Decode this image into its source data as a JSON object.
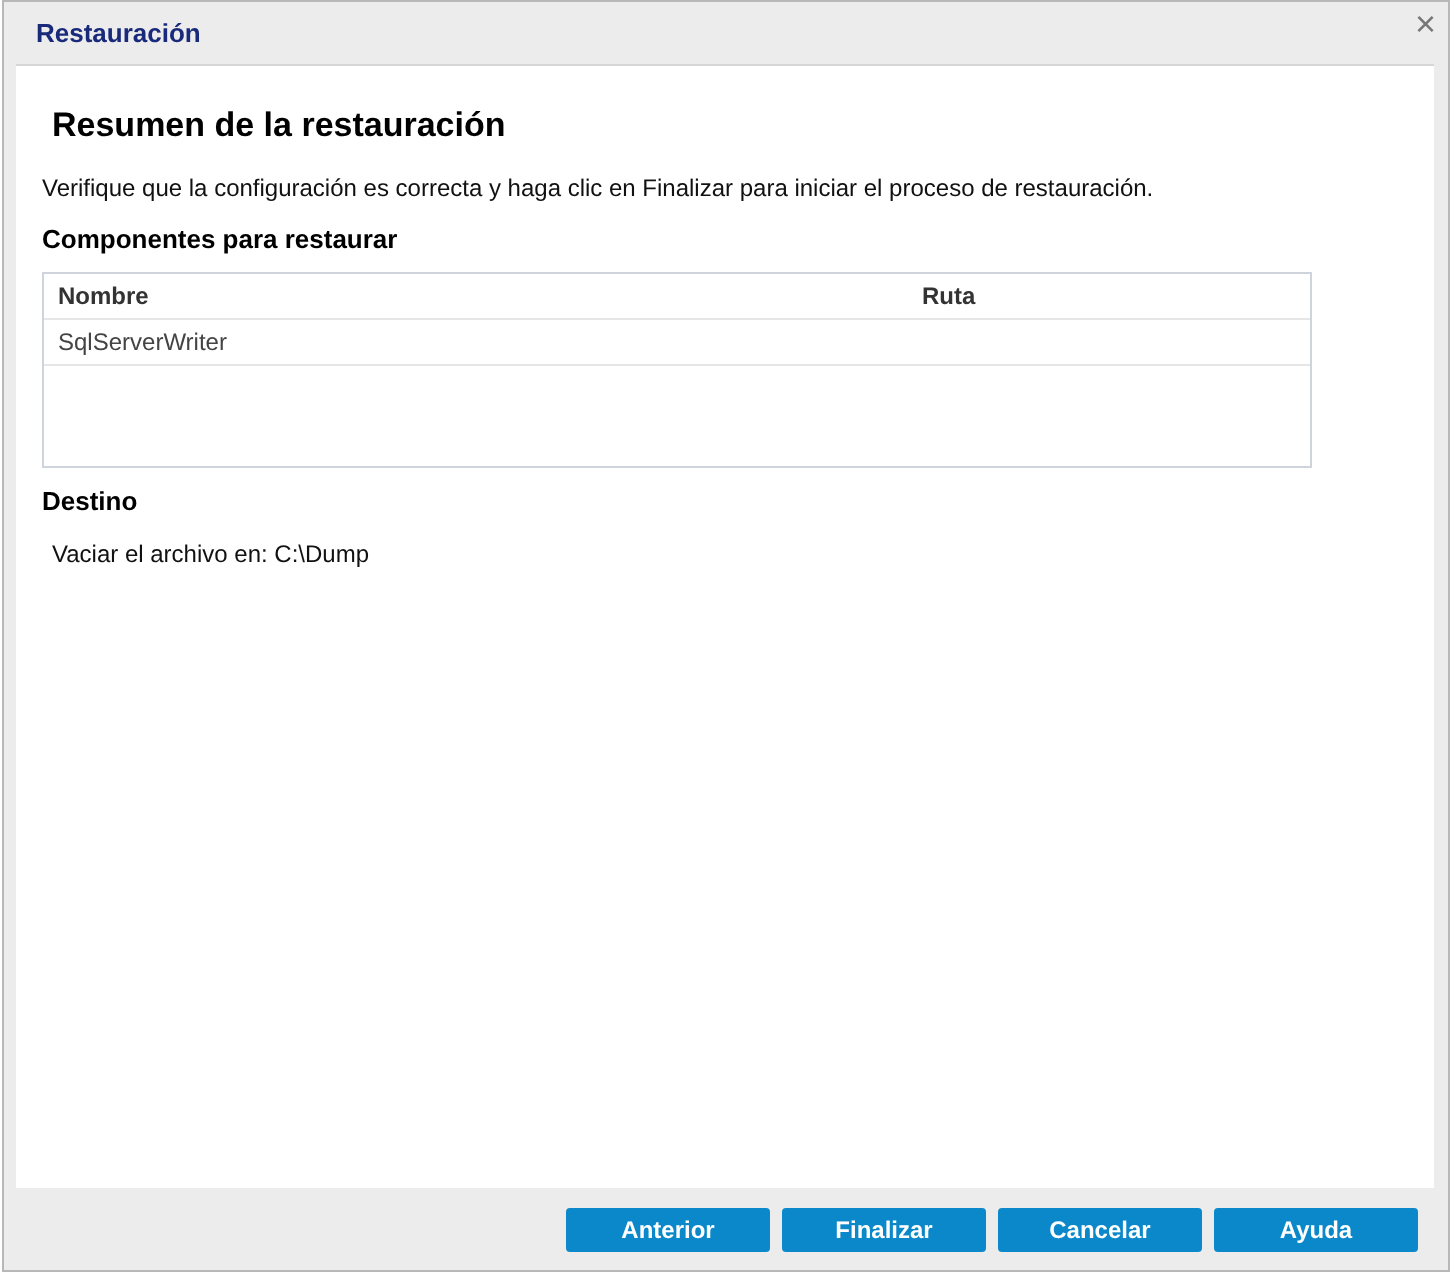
{
  "window": {
    "title": "Restauración",
    "close": "×"
  },
  "heading": "Resumen de la restauración",
  "instructions": "Verifique que la configuración es correcta y haga clic en Finalizar para iniciar el proceso de restauración.",
  "components": {
    "title": "Componentes para restaurar",
    "columns": [
      "Nombre",
      "Ruta"
    ],
    "rows": [
      {
        "cells": [
          "SqlServerWriter",
          ""
        ]
      }
    ]
  },
  "destination": {
    "title": "Destino",
    "text": "Vaciar el archivo en: C:\\Dump"
  },
  "buttons": [
    "Anterior",
    "Finalizar",
    "Cancelar",
    "Ayuda"
  ]
}
